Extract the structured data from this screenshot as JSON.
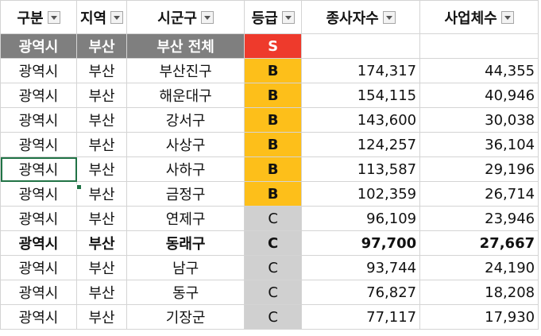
{
  "headers": [
    "구분",
    "지역",
    "시군구",
    "등급",
    "종사자수",
    "사업체수"
  ],
  "total_row": {
    "type": "광역시",
    "region": "부산",
    "district": "부산 전체",
    "grade": "S"
  },
  "rows": [
    {
      "type": "광역시",
      "region": "부산",
      "district": "부산진구",
      "grade": "B",
      "employees": "174,317",
      "businesses": "44,355"
    },
    {
      "type": "광역시",
      "region": "부산",
      "district": "해운대구",
      "grade": "B",
      "employees": "154,115",
      "businesses": "40,946"
    },
    {
      "type": "광역시",
      "region": "부산",
      "district": "강서구",
      "grade": "B",
      "employees": "143,600",
      "businesses": "30,038"
    },
    {
      "type": "광역시",
      "region": "부산",
      "district": "사상구",
      "grade": "B",
      "employees": "124,257",
      "businesses": "36,104"
    },
    {
      "type": "광역시",
      "region": "부산",
      "district": "사하구",
      "grade": "B",
      "employees": "113,587",
      "businesses": "29,196"
    },
    {
      "type": "광역시",
      "region": "부산",
      "district": "금정구",
      "grade": "B",
      "employees": "102,359",
      "businesses": "26,714"
    },
    {
      "type": "광역시",
      "region": "부산",
      "district": "연제구",
      "grade": "C",
      "employees": "96,109",
      "businesses": "23,946"
    },
    {
      "type": "광역시",
      "region": "부산",
      "district": "동래구",
      "grade": "C",
      "employees": "97,700",
      "businesses": "27,667"
    },
    {
      "type": "광역시",
      "region": "부산",
      "district": "남구",
      "grade": "C",
      "employees": "93,744",
      "businesses": "24,190"
    },
    {
      "type": "광역시",
      "region": "부산",
      "district": "동구",
      "grade": "C",
      "employees": "76,827",
      "businesses": "18,208"
    },
    {
      "type": "광역시",
      "region": "부산",
      "district": "기장군",
      "grade": "C",
      "employees": "77,117",
      "businesses": "17,930"
    }
  ],
  "colors": {
    "grade_S": "#ee3a2c",
    "grade_B": "#fdbf1a",
    "grade_C": "#d0d0d0",
    "total_row_bg": "#7f7f7f",
    "selection": "#217346"
  },
  "icons": {
    "filter": "filter-dropdown-icon"
  }
}
